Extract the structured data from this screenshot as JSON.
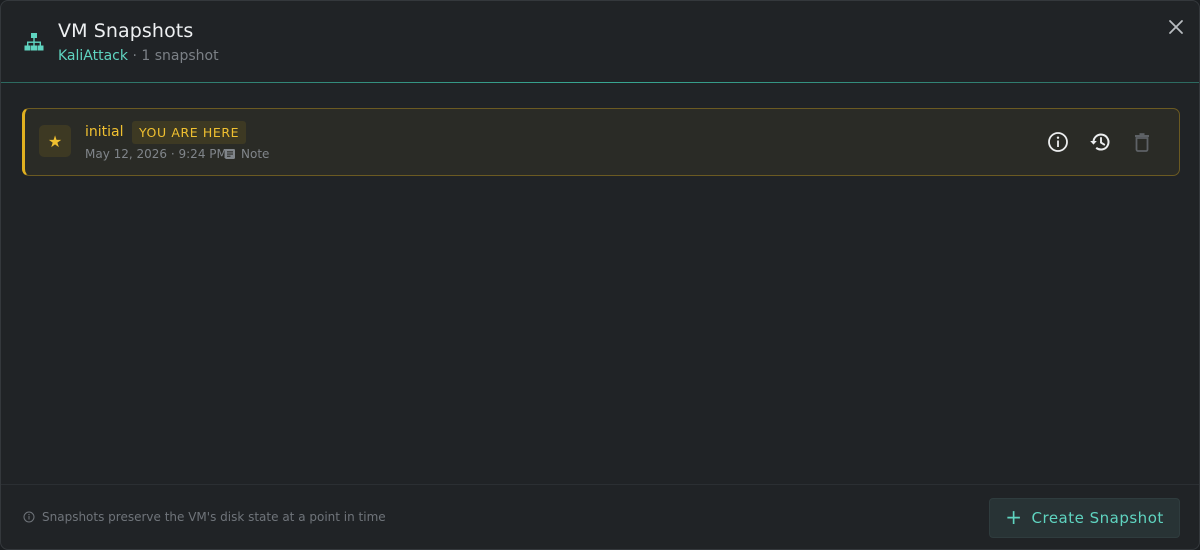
{
  "header": {
    "title": "VM Snapshots",
    "vm_name": "KaliAttack",
    "count_text": " · 1 snapshot",
    "icon": "sitemap-icon",
    "close_icon": "close-icon"
  },
  "snapshots": [
    {
      "name": "initial",
      "badge": "YOU ARE HERE",
      "date": "May 12, 2026 · 9:24 PM",
      "note_label": "Note",
      "icon": "star-icon",
      "actions": [
        "info-icon",
        "restore-icon",
        "delete-icon"
      ]
    }
  ],
  "footer": {
    "hint": "Snapshots preserve the VM's disk state at a point in time",
    "create_button": "Create Snapshot"
  },
  "colors": {
    "accent": "#5fd4c0",
    "current": "#f0c030",
    "background": "#202326"
  }
}
